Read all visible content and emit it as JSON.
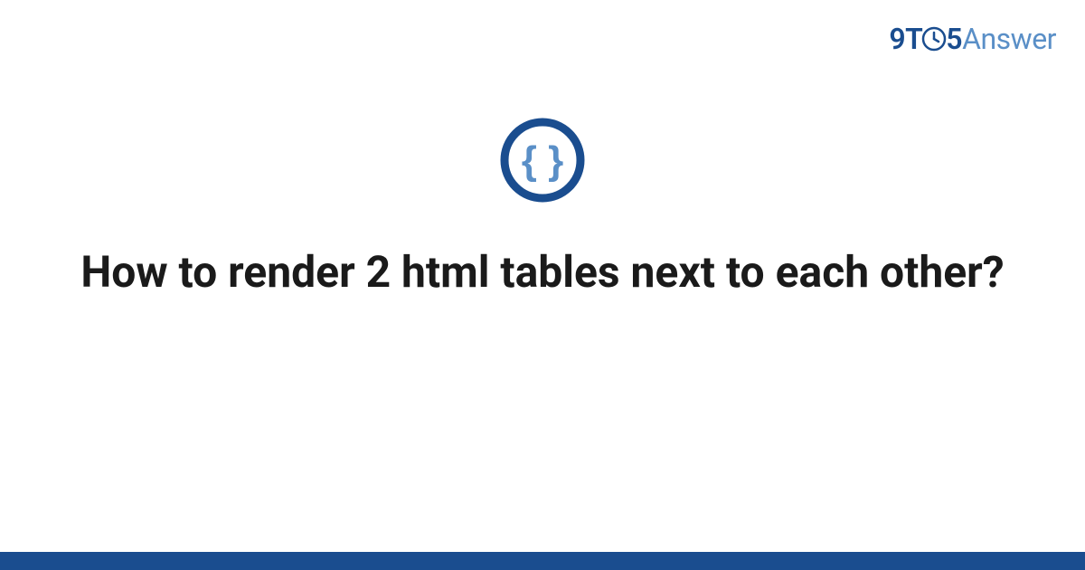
{
  "brand": {
    "prefix": "9T",
    "middle": "5",
    "suffix": "Answer"
  },
  "icon": {
    "name": "css-braces-icon"
  },
  "question": {
    "title": "How to render 2 html tables next to each other?"
  },
  "colors": {
    "brand_dark": "#1a4d8f",
    "brand_light": "#5a8fc7",
    "text": "#1a1a1a"
  }
}
